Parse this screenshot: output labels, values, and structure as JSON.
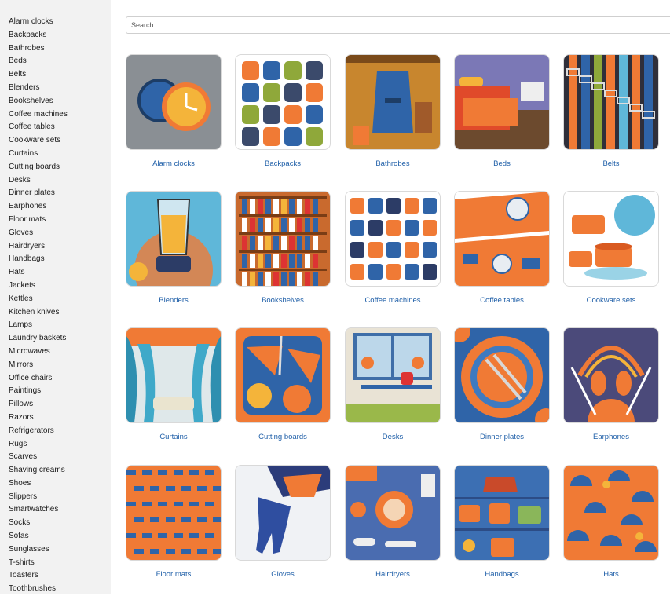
{
  "sidebar": {
    "items": [
      "Alarm clocks",
      "Backpacks",
      "Bathrobes",
      "Beds",
      "Belts",
      "Blenders",
      "Bookshelves",
      "Coffee machines",
      "Coffee tables",
      "Cookware sets",
      "Curtains",
      "Cutting boards",
      "Desks",
      "Dinner plates",
      "Earphones",
      "Floor mats",
      "Gloves",
      "Hairdryers",
      "Handbags",
      "Hats",
      "Jackets",
      "Kettles",
      "Kitchen knives",
      "Lamps",
      "Laundry baskets",
      "Microwaves",
      "Mirrors",
      "Office chairs",
      "Paintings",
      "Pillows",
      "Razors",
      "Refrigerators",
      "Rugs",
      "Scarves",
      "Shaving creams",
      "Shoes",
      "Slippers",
      "Smartwatches",
      "Socks",
      "Sofas",
      "Sunglasses",
      "T-shirts",
      "Toasters",
      "Toothbrushes"
    ]
  },
  "search": {
    "placeholder": "Search..."
  },
  "grid": {
    "items": [
      {
        "label": "Alarm clocks",
        "image": "alarm-clocks-image"
      },
      {
        "label": "Backpacks",
        "image": "backpacks-image"
      },
      {
        "label": "Bathrobes",
        "image": "bathrobes-image"
      },
      {
        "label": "Beds",
        "image": "beds-image"
      },
      {
        "label": "Belts",
        "image": "belts-image"
      },
      {
        "label": "Blenders",
        "image": "blenders-image"
      },
      {
        "label": "Bookshelves",
        "image": "bookshelves-image"
      },
      {
        "label": "Coffee machines",
        "image": "coffee-machines-image"
      },
      {
        "label": "Coffee tables",
        "image": "coffee-tables-image"
      },
      {
        "label": "Cookware sets",
        "image": "cookware-sets-image"
      },
      {
        "label": "Curtains",
        "image": "curtains-image"
      },
      {
        "label": "Cutting boards",
        "image": "cutting-boards-image"
      },
      {
        "label": "Desks",
        "image": "desks-image"
      },
      {
        "label": "Dinner plates",
        "image": "dinner-plates-image"
      },
      {
        "label": "Earphones",
        "image": "earphones-image"
      },
      {
        "label": "Floor mats",
        "image": "floor-mats-image"
      },
      {
        "label": "Gloves",
        "image": "gloves-image"
      },
      {
        "label": "Hairdryers",
        "image": "hairdryers-image"
      },
      {
        "label": "Handbags",
        "image": "handbags-image"
      },
      {
        "label": "Hats",
        "image": "hats-image"
      }
    ]
  },
  "colors": {
    "link": "#1f5fa8",
    "orange": "#f07a35",
    "blue": "#2f64a8",
    "sidebar_bg": "#f2f2f2"
  }
}
